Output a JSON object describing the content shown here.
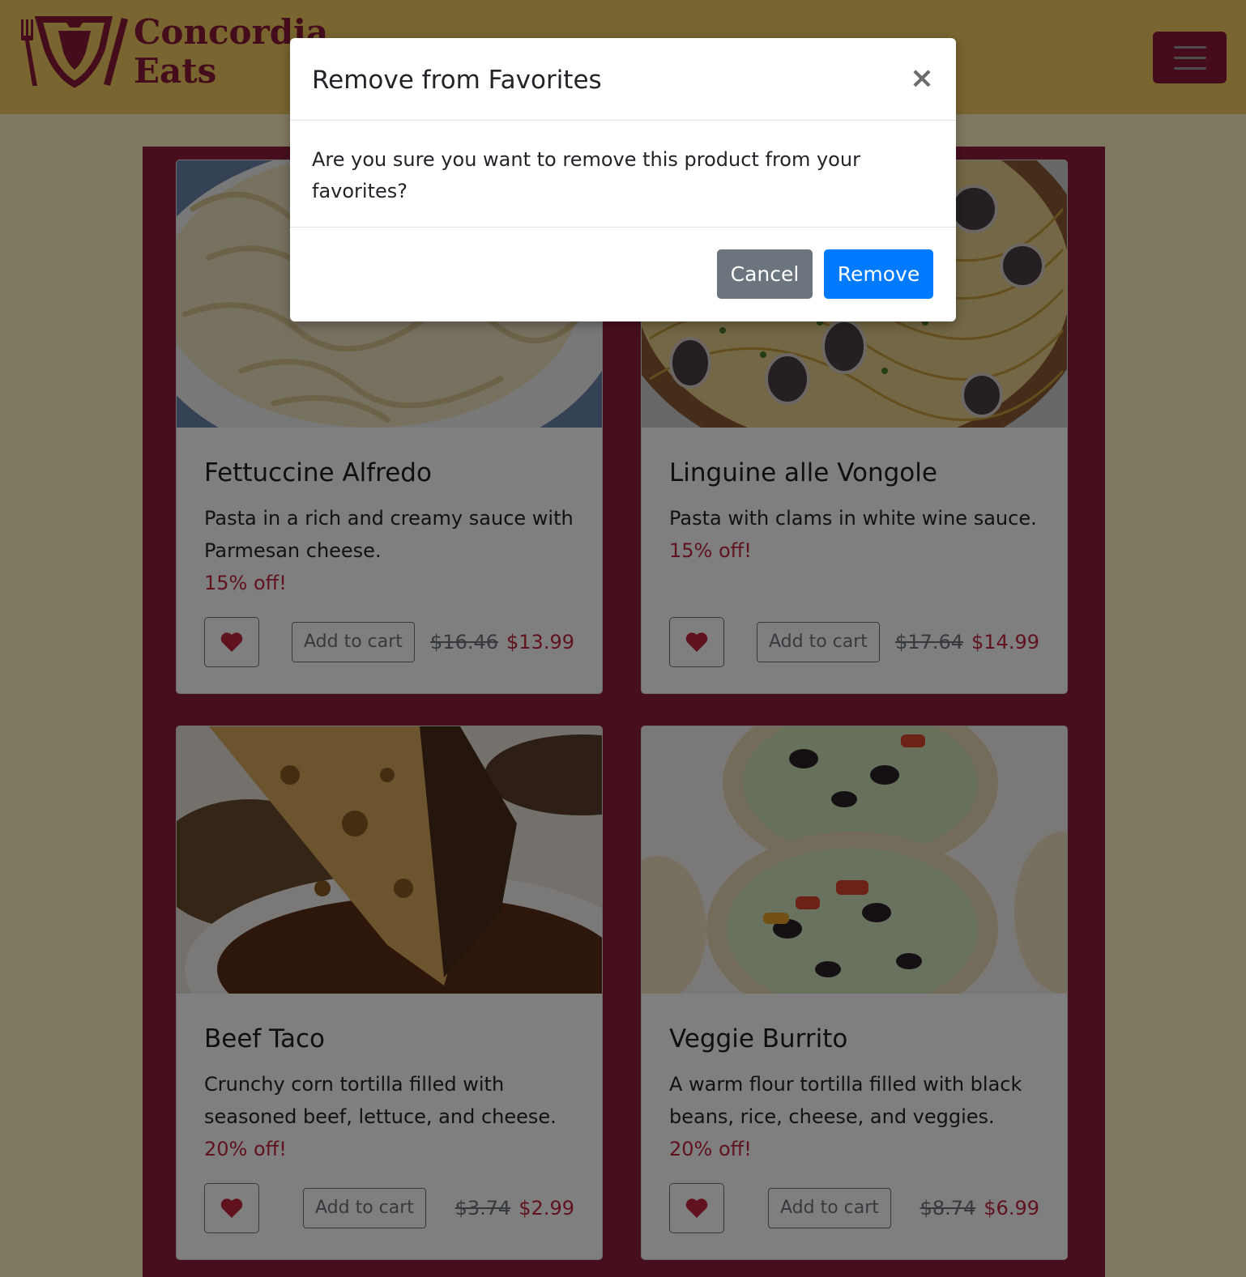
{
  "header": {
    "brand_line1": "Concordia",
    "brand_line2": "Eats",
    "logo_icon": "shield-fork-knife-logo",
    "menu_icon": "hamburger-icon",
    "colors": {
      "bar": "#f2cb5e",
      "brand": "#8a1a36"
    }
  },
  "products": [
    {
      "title": "Fettuccine Alfredo",
      "description": "Pasta in a rich and creamy sauce with Parmesan cheese.",
      "discount": "15% off!",
      "cart_label": "Add to cart",
      "old_price": "$16.46",
      "new_price": "$13.99",
      "image": "fettuccine-photo"
    },
    {
      "title": "Linguine alle Vongole",
      "description": "Pasta with clams in white wine sauce.",
      "discount": "15% off!",
      "cart_label": "Add to cart",
      "old_price": "$17.64",
      "new_price": "$14.99",
      "image": "linguine-clams-photo"
    },
    {
      "title": "Beef Taco",
      "description": "Crunchy corn tortilla filled with seasoned beef, lettuce, and cheese.",
      "discount": "20% off!",
      "cart_label": "Add to cart",
      "old_price": "$3.74",
      "new_price": "$2.99",
      "image": "beef-taco-photo"
    },
    {
      "title": "Veggie Burrito",
      "description": "A warm flour tortilla filled with black beans, rice, cheese, and veggies.",
      "discount": "20% off!",
      "cart_label": "Add to cart",
      "old_price": "$8.74",
      "new_price": "$6.99",
      "image": "veggie-burrito-photo"
    }
  ],
  "modal": {
    "title": "Remove from Favorites",
    "close_symbol": "×",
    "message": "Are you sure you want to remove this product from your favorites?",
    "cancel_label": "Cancel",
    "remove_label": "Remove",
    "colors": {
      "cancel": "#6c757d",
      "remove": "#007bff"
    }
  },
  "colors": {
    "page_bg": "#fff2c4",
    "panel": "#8f1f3c",
    "discount": "#c0263c",
    "heart": "#c0263c"
  }
}
